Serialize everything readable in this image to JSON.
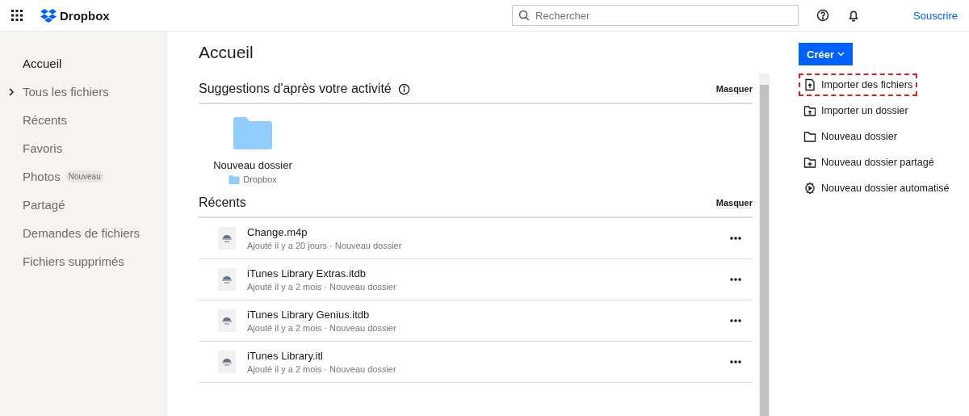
{
  "header": {
    "brand": "Dropbox",
    "search": {
      "placeholder": "Rechercher"
    },
    "subscribe": "Souscrire"
  },
  "sidebar": {
    "items": [
      {
        "label": "Accueil",
        "selected": true,
        "expandable": false
      },
      {
        "label": "Tous les fichiers",
        "selected": false,
        "expandable": true
      },
      {
        "label": "Récents",
        "selected": false,
        "expandable": false
      },
      {
        "label": "Favoris",
        "selected": false,
        "expandable": false
      },
      {
        "label": "Photos",
        "selected": false,
        "expandable": false,
        "badge": "Nouveau"
      },
      {
        "label": "Partagé",
        "selected": false,
        "expandable": false
      },
      {
        "label": "Demandes de fichiers",
        "selected": false,
        "expandable": false
      },
      {
        "label": "Fichiers supprimés",
        "selected": false,
        "expandable": false
      }
    ]
  },
  "main": {
    "title": "Accueil",
    "suggestions": {
      "title": "Suggestions d'après votre activité",
      "hide": "Masquer",
      "items": [
        {
          "name": "Nouveau dossier",
          "location": "Dropbox"
        }
      ]
    },
    "recents": {
      "title": "Récents",
      "hide": "Masquer",
      "rows": [
        {
          "name": "Change.m4p",
          "meta": "Ajouté il y a 20 jours · Nouveau dossier"
        },
        {
          "name": "iTunes Library Extras.itdb",
          "meta": "Ajouté il y a 2 mois · Nouveau dossier"
        },
        {
          "name": "iTunes Library Genius.itdb",
          "meta": "Ajouté il y a 2 mois · Nouveau dossier"
        },
        {
          "name": "iTunes Library.itl",
          "meta": "Ajouté il y a 2 mois · Nouveau dossier"
        }
      ]
    }
  },
  "actions": {
    "create": "Créer",
    "items": [
      {
        "kind": "upload-file",
        "label": "Importer des fichiers",
        "highlighted": true
      },
      {
        "kind": "upload-folder",
        "label": "Importer un dossier",
        "highlighted": false
      },
      {
        "kind": "folder",
        "label": "Nouveau dossier",
        "highlighted": false
      },
      {
        "kind": "shared-folder",
        "label": "Nouveau dossier partagé",
        "highlighted": false
      },
      {
        "kind": "auto-folder",
        "label": "Nouveau dossier automatisé",
        "highlighted": false
      }
    ]
  }
}
